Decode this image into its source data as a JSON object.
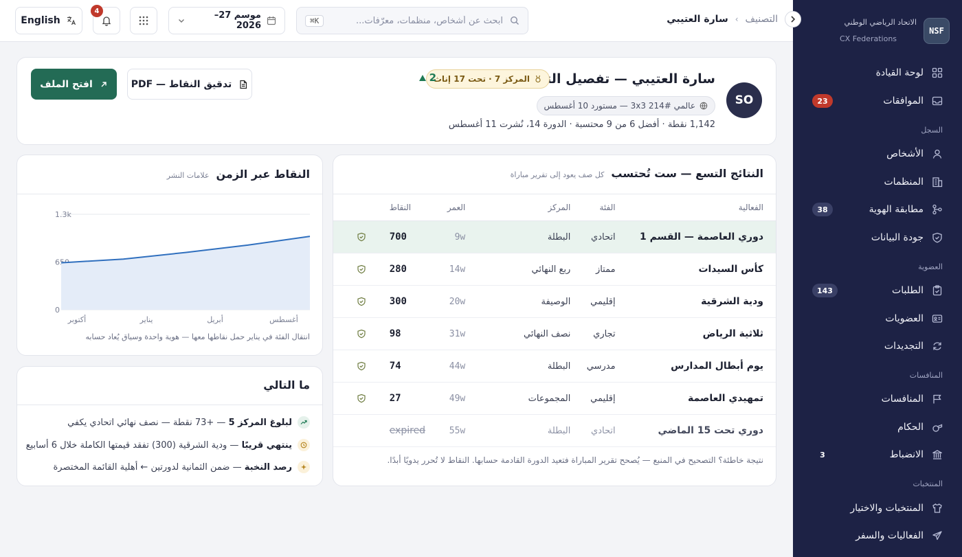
{
  "brand": {
    "logo": "NSF",
    "name": "الاتحاد الرياضي الوطني",
    "sub": "CX Federations"
  },
  "sidebar": {
    "dashboard": "لوحة القيادة",
    "approvals": {
      "label": "الموافقات",
      "badge": "23"
    },
    "registry_section": "السجل",
    "people": "الأشخاص",
    "organizations": "المنظمات",
    "identity": {
      "label": "مطابقة الهوية",
      "badge": "38"
    },
    "data_quality": "جودة البيانات",
    "membership_section": "العضوية",
    "applications": {
      "label": "الطلبات",
      "badge": "143"
    },
    "memberships": "العضويات",
    "renewals": "التجديدات",
    "competitions_section": "المنافسات",
    "competitions": "المنافسات",
    "referees": "الحكام",
    "discipline": {
      "label": "الانضباط",
      "badge": "3"
    },
    "teams_section": "المنتخبات",
    "teams_selection": "المنتخبات والاختيار",
    "events_travel": "الفعاليات والسفر"
  },
  "topbar": {
    "breadcrumb_parent": "التصنيف",
    "breadcrumb_current": "سارة العتيبي",
    "search_placeholder": "ابحث عن أشخاص، منظمات، معرّفات...",
    "search_shortcut": "⌘K",
    "season": "موسم 27–2026",
    "notifications_count": "4",
    "language": "English"
  },
  "profile": {
    "initials": "SO",
    "title": "سارة العتيبي — تفصيل التصنيف",
    "rank_pill": "المركز 7 · تحت 17 إناث",
    "delta": "2",
    "ref_pill": "عالمي #214 3x3 — مستورد 10 أغسطس",
    "meta": "1,142 نقطة · أفضل 6 من 9 محتسبة · الدورة 14، نُشرت 11 أغسطس",
    "open_button": "افتح الملف",
    "pdf_button": "تدقيق النقاط — PDF"
  },
  "results": {
    "title": "النتائج التسع — ست تُحتسب",
    "subtitle": "كل صف يعود إلى تقرير مباراة",
    "columns": {
      "event": "الفعالية",
      "category": "الفئة",
      "position": "المركز",
      "age": "العمر",
      "points": "النقاط"
    },
    "rows": [
      {
        "event": "دوري العاصمة — القسم 1",
        "category": "اتحادي",
        "position": "البطلة",
        "age": "9w",
        "points": "700"
      },
      {
        "event": "كأس السيدات",
        "category": "ممتاز",
        "position": "ربع النهائي",
        "age": "14w",
        "points": "280"
      },
      {
        "event": "ودية الشرقية",
        "category": "إقليمي",
        "position": "الوصيفة",
        "age": "20w",
        "points": "300"
      },
      {
        "event": "ثلاثية الرياض",
        "category": "تجاري",
        "position": "نصف النهائي",
        "age": "31w",
        "points": "98"
      },
      {
        "event": "يوم أبطال المدارس",
        "category": "مدرسي",
        "position": "البطلة",
        "age": "44w",
        "points": "74"
      },
      {
        "event": "تمهيدي العاصمة",
        "category": "إقليمي",
        "position": "المجموعات",
        "age": "49w",
        "points": "27"
      },
      {
        "event": "دوري تحت 15 الماضي",
        "category": "اتحادي",
        "position": "البطلة",
        "age": "55w",
        "points": "expired"
      }
    ],
    "footer": "نتيجة خاطئة؟ التصحيح في المنبع — يُصحح تقرير المباراة فتعيد الدورة القادمة حسابها. النقاط لا تُحرر يدويًا أبدًا."
  },
  "chart_card": {
    "title": "النقاط عبر الزمن",
    "subtitle": "علامات النشر",
    "note": "انتقال الفئة في يناير حمل نقاطها معها — هوية واحدة وسياق يُعاد حسابه"
  },
  "chart_data": {
    "type": "area",
    "title": "النقاط عبر الزمن",
    "x_ticks": [
      "أكتوبر",
      "يناير",
      "أبريل",
      "أغسطس"
    ],
    "y_ticks": [
      "0",
      "650",
      "1.3k"
    ],
    "ylim": [
      0,
      1300
    ],
    "x": [
      0,
      1,
      2,
      3,
      4
    ],
    "values": [
      640,
      690,
      780,
      880,
      1000
    ],
    "color": "#2f6fbe",
    "fill": "#e4ecf8",
    "grid": true
  },
  "next": {
    "title": "ما التالي",
    "items": [
      {
        "bold": "لبلوغ المركز 5",
        "text": " — +73 نقطة — نصف نهائي اتحادي يكفي"
      },
      {
        "bold": "ينتهي قريبًا",
        "text": " — ودية الشرقية (300) تفقد قيمتها الكاملة خلال 6 أسابيع"
      },
      {
        "bold": "رصد النخبة",
        "text": " — ضمن الثمانية لدورتين ← أهلية القائمة المختصرة"
      }
    ]
  }
}
